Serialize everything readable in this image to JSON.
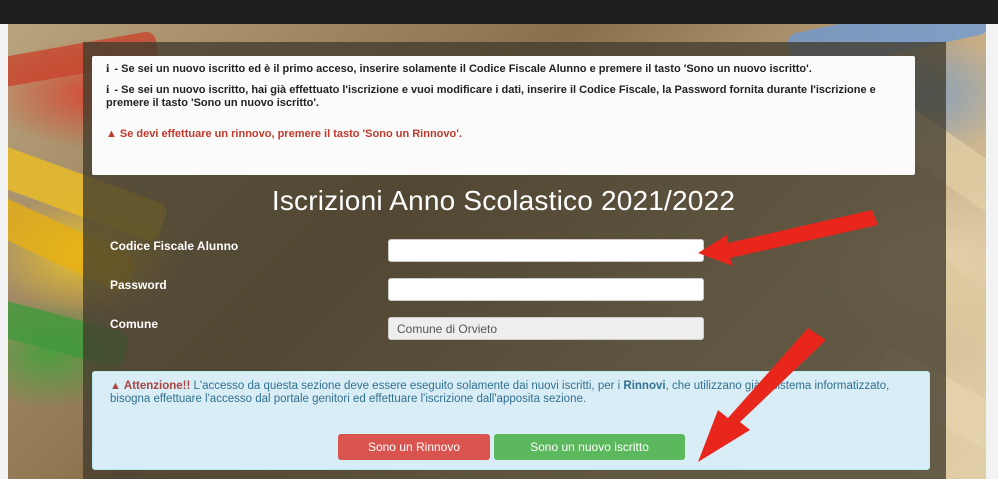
{
  "info": {
    "line1": "Se sei un nuovo iscritto ed è il primo acceso, inserire solamente il Codice Fiscale Alunno e premere il tasto 'Sono un nuovo iscritto'.",
    "line2": "Se sei un nuovo iscritto, hai già effettuato l'iscrizione e vuoi modificare i dati, inserire il Codice Fiscale, la Password fornita durante l'iscrizione e premere il tasto 'Sono un nuovo iscritto'.",
    "warning": "Se devi effettuare un rinnovo, premere il tasto 'Sono un Rinnovo'.",
    "info_glyph": "i",
    "dash": " - "
  },
  "title": "Iscrizioni Anno Scolastico 2021/2022",
  "form": {
    "codice_label": "Codice Fiscale Alunno",
    "codice_value": "",
    "password_label": "Password",
    "password_value": "",
    "comune_label": "Comune",
    "comune_value": "Comune di Orvieto"
  },
  "alert": {
    "strong": "Attenzione!!",
    "text_a": " L'accesso da questa sezione deve essere eseguito solamente dai nuovi iscritti, ",
    "hidden_mid": "per i",
    "strong2": "Rinnovi",
    "text_b": ", che utilizzano già il sistema informatizzato, bisogna effettuare l'accesso dal portale genitori ed effet",
    "hidden_mid2": "tuare l",
    "text_c": "'iscrizione dall'apposita sezione."
  },
  "buttons": {
    "rinnovo": "Sono un Rinnovo",
    "nuovo": "Sono un nuovo iscritto"
  },
  "colors": {
    "arrow": "#e8261c",
    "btn_red": "#d9534f",
    "btn_green": "#5cb85c"
  },
  "icons": [
    "info-icon",
    "warning-icon",
    "arrow-annotation"
  ]
}
